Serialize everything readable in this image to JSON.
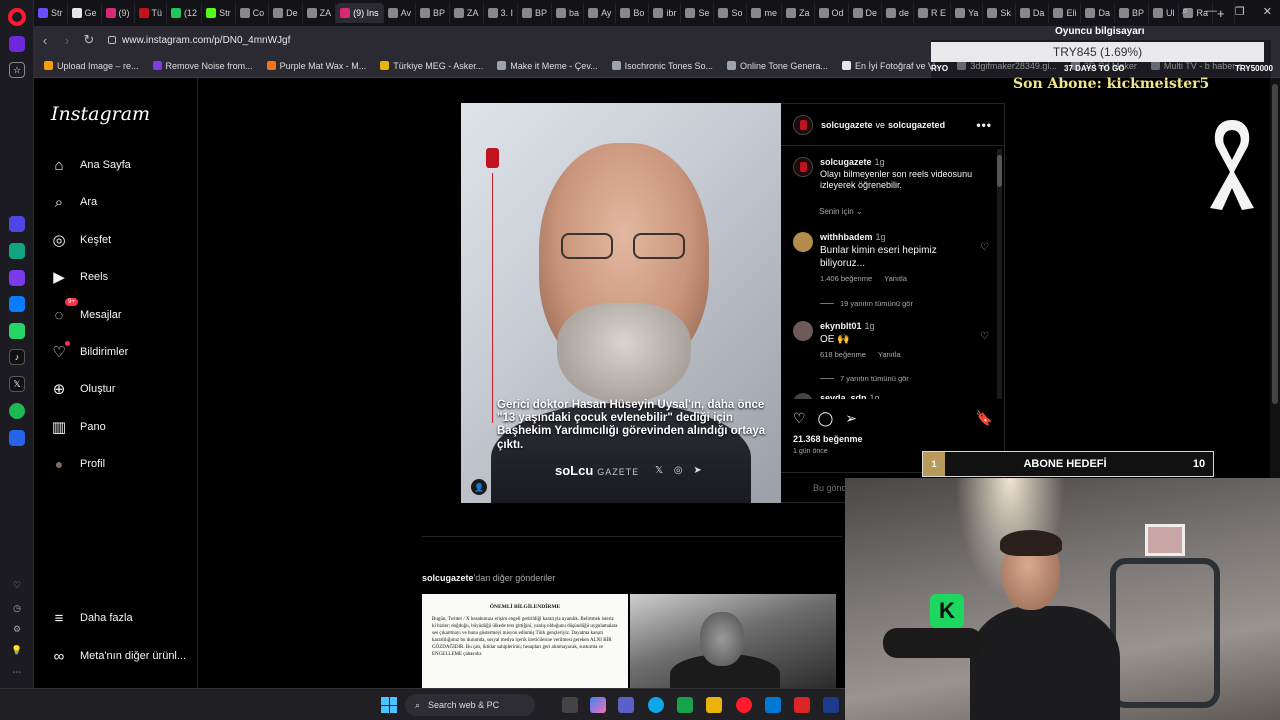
{
  "browser": {
    "tabs": [
      {
        "label": "Str",
        "color": "#6b4cff"
      },
      {
        "label": "Ge",
        "color": "#e6e6e6"
      },
      {
        "label": "(9)",
        "color": "#d62976"
      },
      {
        "label": "Tü",
        "color": "#c1121f"
      },
      {
        "label": "(12",
        "color": "#22c55e"
      },
      {
        "label": "Str",
        "color": "#53fc18"
      },
      {
        "label": "Co",
        "color": "#888"
      },
      {
        "label": "De",
        "color": "#888"
      },
      {
        "label": "ZA",
        "color": "#888"
      },
      {
        "label": "(9) Ins",
        "color": "#d62976"
      },
      {
        "label": "Av",
        "color": "#888"
      },
      {
        "label": "BP",
        "color": "#888"
      },
      {
        "label": "ZA",
        "color": "#888"
      },
      {
        "label": "3. I",
        "color": "#888"
      },
      {
        "label": "BP",
        "color": "#888"
      },
      {
        "label": "ba",
        "color": "#888"
      },
      {
        "label": "Ay",
        "color": "#888"
      },
      {
        "label": "Bo",
        "color": "#888"
      },
      {
        "label": "ibr",
        "color": "#888"
      },
      {
        "label": "Se",
        "color": "#888"
      },
      {
        "label": "So",
        "color": "#888"
      },
      {
        "label": "me",
        "color": "#888"
      },
      {
        "label": "Za",
        "color": "#888"
      },
      {
        "label": "Od",
        "color": "#888"
      },
      {
        "label": "De",
        "color": "#888"
      },
      {
        "label": "de",
        "color": "#888"
      },
      {
        "label": "R E",
        "color": "#888"
      },
      {
        "label": "Ya",
        "color": "#888"
      },
      {
        "label": "Sk",
        "color": "#888"
      },
      {
        "label": "Da",
        "color": "#888"
      },
      {
        "label": "Eli",
        "color": "#888"
      },
      {
        "label": "Da",
        "color": "#888"
      },
      {
        "label": "BP",
        "color": "#888"
      },
      {
        "label": "Ul",
        "color": "#888"
      },
      {
        "label": "Ra",
        "color": "#888"
      }
    ],
    "active_tab_index": 9,
    "new_tab": "+",
    "url": "www.instagram.com/p/DN0_4mnWJgf",
    "bookmarks": [
      {
        "label": "Upload Image – re...",
        "color": "#f59e0b"
      },
      {
        "label": "Remove Noise from...",
        "color": "#7c3aed"
      },
      {
        "label": "Purple Mat Wax - M...",
        "color": "#f97316"
      },
      {
        "label": "Türkiye MEG - Asker...",
        "color": "#eab308"
      },
      {
        "label": "Make it Meme - Çev...",
        "color": "#9ca3af"
      },
      {
        "label": "Isochronic Tones So...",
        "color": "#9ca3af"
      },
      {
        "label": "Online Tone Genera...",
        "color": "#9ca3af"
      },
      {
        "label": "En İyi Fotoğraf ve Vi...",
        "color": "#e5e7eb"
      },
      {
        "label": "3dgifmaker28349.gi...",
        "color": "#9ca3af"
      },
      {
        "label": "3D Gif Maker",
        "color": "#9ca3af"
      },
      {
        "label": "Multi TV - b haber c...",
        "color": "#9ca3af"
      }
    ]
  },
  "instagram": {
    "logo": "Instagram",
    "nav": [
      {
        "label": "Ana Sayfa",
        "icon": "home-icon"
      },
      {
        "label": "Ara",
        "icon": "search-icon"
      },
      {
        "label": "Keşfet",
        "icon": "compass-icon"
      },
      {
        "label": "Reels",
        "icon": "reels-icon"
      },
      {
        "label": "Mesajlar",
        "icon": "messenger-icon",
        "badge": "9+"
      },
      {
        "label": "Bildirimler",
        "icon": "heart-icon"
      },
      {
        "label": "Oluştur",
        "icon": "plus-icon"
      },
      {
        "label": "Pano",
        "icon": "dashboard-icon"
      },
      {
        "label": "Profil",
        "icon": "avatar"
      }
    ],
    "nav_bottom": [
      {
        "label": "Daha fazla",
        "icon": "menu-icon"
      },
      {
        "label": "Meta'nın diğer ürünl...",
        "icon": "meta-icon"
      }
    ],
    "post": {
      "image_caption": "Gerici doktor Hasan Hüseyin Uysal'ın, daha önce \"13 yaşındaki çocuk evlenebilir\" dediği için Başhekim Yardımcılığı görevinden alındığı ortaya çıktı.",
      "image_brand": "soLcu",
      "image_brand_sub": "GAZETE",
      "image_social": "𝕏 ◎ ➤",
      "header_user1": "solcugazete",
      "header_joiner": "ve",
      "header_user2": "solcugazeted",
      "author": "solcugazete",
      "author_time": "1g",
      "author_text": "Olayı bilmeyenler son reels videosunu izleyerek öğrenebilir.",
      "for_you": "Senin için",
      "comments": [
        {
          "user": "withhbadem",
          "time": "1g",
          "text": "Bunlar kimin eseri hepimiz biliyoruz...",
          "likes": "1.406 beğenme",
          "reply": "Yanıtla",
          "replies": "19 yanıtın tümünü gör",
          "avatar_color": "#b38b4d"
        },
        {
          "user": "ekynblt01",
          "time": "1g",
          "text": "OE 🙌",
          "likes": "618 beğenme",
          "reply": "Yanıtla",
          "replies": "7 yanıtın tümünü gör",
          "avatar_color": "#6b5a55"
        },
        {
          "user": "sevda_sdn",
          "time": "1g",
          "text": "",
          "likes": "",
          "reply": "",
          "replies": "",
          "avatar_color": "#444"
        }
      ],
      "likes": "21.368 beğenme",
      "posted": "1 gün önce",
      "add_comment_placeholder": "Bu gönderiye yorum yap..."
    },
    "more_posts_user": "solcugazete",
    "more_posts_suffix": "'dan diğer gönderiler",
    "thumb1_title": "ÖNEMLİ BİLGİLENDİRME",
    "thumb1_text": "Bugün, Twitter / X hesabımıza erişim engeli getirildiği kararıyla uyandık. Belirtmek isteriz ki bizler; doğduğu, büyüdüğü ülkede ters gittiğini, yanlış olduğunu düşündüğü uygulamalara ses çıkartmayı ve bunu göstermeyi misyon edinmiş Türk gençleriyiz. Dayatma karşıtı kararlılığımız bu durumda, sosyal medya içerik üreticilerine verilmesi gereken ALNI BİR GÖZDAĞIDIR. Bu çatı, iktidar sahiplerinin; hesapları geri alınmayacak, susturma ve ENGELLEME çabasıdır."
  },
  "overlay": {
    "donate_title": "Oyuncu bilgisayarı",
    "donate_amount": "TRY845 (1.69%)",
    "donate_left": "RYO",
    "donate_mid": "37 DAYS TO GO",
    "donate_right": "TRY50000",
    "son_abone": "Son Abone: kickmeister5",
    "goal_label": "ABONE HEDEFİ",
    "goal_current": "1",
    "goal_target": "10",
    "goal_progress": 0.1
  },
  "taskbar": {
    "search": "Search web & PC"
  }
}
